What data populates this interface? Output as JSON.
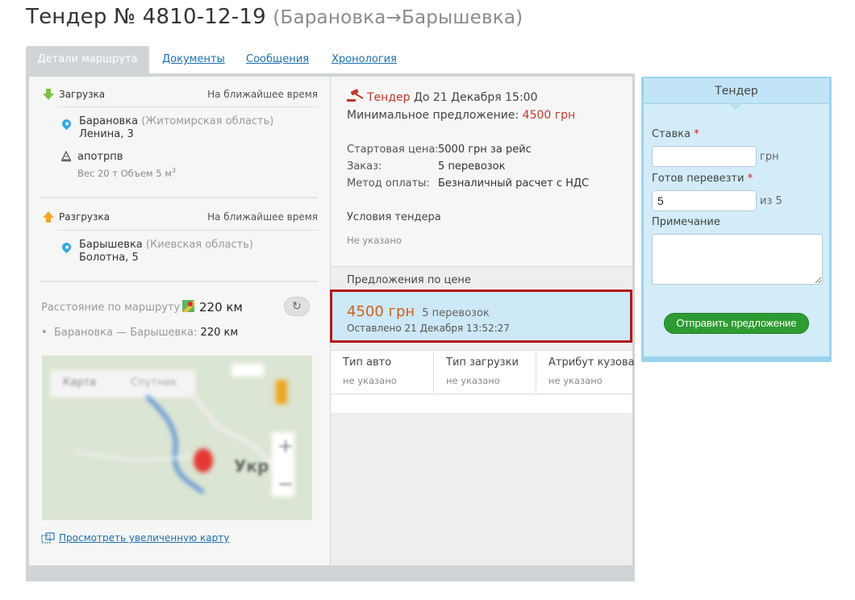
{
  "header": {
    "title": "Тендер № 4810-12-19",
    "subtitle": "(Барановка→Барышевка)"
  },
  "tabs": [
    {
      "label": "Детали маршрута",
      "active": true
    },
    {
      "label": "Документы"
    },
    {
      "label": "Сообщения"
    },
    {
      "label": "Хронология"
    }
  ],
  "loading": {
    "label": "Загрузка",
    "time": "На ближайшее время",
    "city": "Барановка",
    "region": "(Житомирская область)",
    "street": "Ленина, 3",
    "cargo_name": "апотрпв",
    "cargo_params": "Вес 20 т  Объем 5 м",
    "cargo_unit_exp": "3"
  },
  "unloading": {
    "label": "Разгрузка",
    "time": "На ближайшее время",
    "city": "Барышевка",
    "region": "(Киевская область)",
    "street": "Болотна, 5"
  },
  "distance": {
    "label": "Расстояние по маршруту —",
    "value": "220 км",
    "segment_label": "Барановка — Барышевка:",
    "segment_value": "220 км"
  },
  "map": {
    "tab_map": "Карта",
    "tab_satellite": "Спутник",
    "zoom_in": "+",
    "zoom_out": "−",
    "place_label": "Укр",
    "enlarge_link": "Просмотреть увеличенную карту"
  },
  "tender": {
    "label": "Тендер",
    "deadline": "До 21 Декабря 15:00",
    "min_offer_label": "Минимальное предложение:",
    "min_offer_value": "4500 грн",
    "start_price_label": "Стартовая цена:",
    "start_price_value": "5000 грн за рейс",
    "order_label": "Заказ:",
    "order_value": "5 перевозок",
    "payment_label": "Метод оплаты:",
    "payment_value": "Безналичный расчет с НДС",
    "conditions_label": "Условия тендера",
    "conditions_value": "Не указано"
  },
  "offers": {
    "label": "Предложения по цене",
    "items": [
      {
        "price": "4500 грн",
        "count": "5 перевозок",
        "date": "Оставлено 21 Декабря 13:52:27"
      }
    ]
  },
  "vehicle": {
    "columns": [
      "Тип авто",
      "Тип загрузки",
      "Атрибут кузова"
    ],
    "values": [
      "не указано",
      "не указано",
      "не указано"
    ]
  },
  "form": {
    "title": "Тендер",
    "bid_label": "Ставка",
    "required_mark": "*",
    "bid_value": "",
    "bid_unit": "грн",
    "ready_label": "Готов перевезти",
    "ready_value": "5",
    "ready_total": "из 5",
    "note_label": "Примечание",
    "note_value": "",
    "submit_label": "Отправить предложение"
  },
  "colors": {
    "accent_red": "#c0392b",
    "link_blue": "#1a6fb0",
    "offer_bg": "#cde8f6",
    "offer_border": "#b21a1a",
    "button_green": "#2e9b32",
    "sidebar_bg": "#d2ecf9"
  }
}
